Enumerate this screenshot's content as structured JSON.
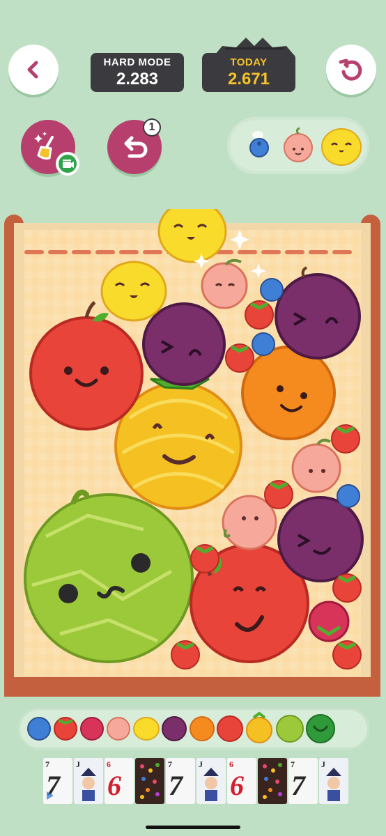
{
  "header": {
    "hard_mode_label": "HARD MODE",
    "hard_mode_value": "2.283",
    "today_label": "TODAY",
    "today_value": "2.671"
  },
  "tools": {
    "undo_count": "1"
  },
  "colors": {
    "background": "#bfe0c4",
    "accent_magenta": "#b63f6e",
    "today_gold": "#f5c22b",
    "box_wood": "#c4603d",
    "score_panel": "#3b3b3f"
  },
  "next_queue": [
    "blueberry",
    "peach",
    "lemon"
  ],
  "evolution": [
    "blueberry",
    "strawberry",
    "raspberry",
    "peach",
    "lemon",
    "plum",
    "orange",
    "apple",
    "pineapple",
    "melon",
    "watermelon"
  ],
  "ad_cards": [
    "7",
    "J",
    "6",
    "candy",
    "7",
    "J",
    "6",
    "candy",
    "7",
    "J"
  ]
}
